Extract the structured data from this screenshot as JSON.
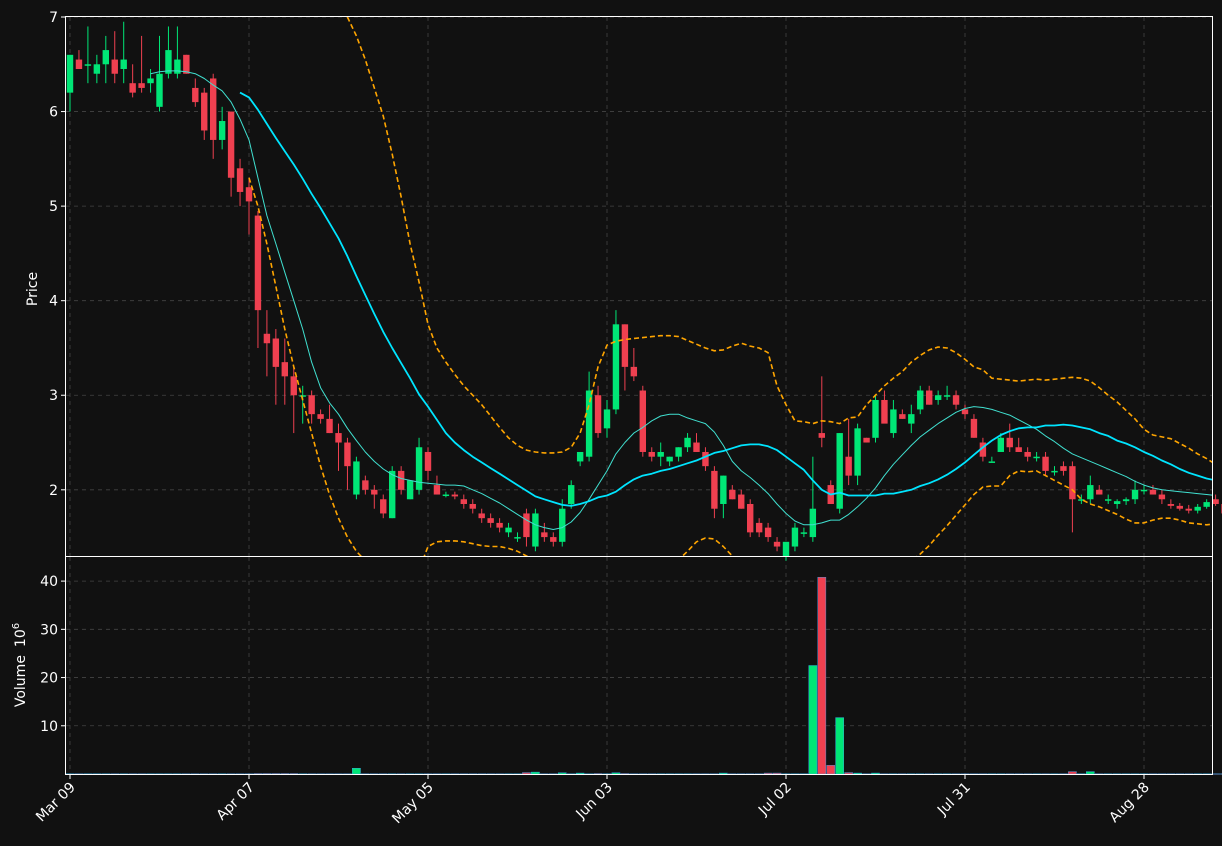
{
  "chart_data": {
    "type": "candlestick",
    "price_panel": {
      "ylabel": "Price",
      "ylim": [
        1.3,
        7.0
      ],
      "yticks": [
        2,
        3,
        4,
        5,
        6,
        7
      ],
      "grid": true
    },
    "volume_panel": {
      "ylabel": "Volume",
      "ylabel_exponent": "6",
      "ylim": [
        0,
        45
      ],
      "yticks": [
        10,
        20,
        30,
        40
      ],
      "grid": true
    },
    "x_axis": {
      "tick_labels": [
        "Mar 09",
        "Apr 07",
        "May 05",
        "Jun 03",
        "Jul 02",
        "Jul 31",
        "Aug 28"
      ],
      "tick_index": [
        0,
        20,
        40,
        60,
        80,
        100,
        120
      ]
    },
    "colors": {
      "background": "#111111",
      "up": "#00e676",
      "down": "#ef4050",
      "grid": "#444444",
      "axis": "#ffffff",
      "ma_fast": "#40e0d0",
      "ma_slow": "#00e5ff",
      "bands": "#ffa500"
    },
    "candles": [
      [
        6.2,
        6.6,
        6.0,
        6.6,
        0.05
      ],
      [
        6.55,
        6.65,
        6.45,
        6.45,
        0.05
      ],
      [
        6.5,
        6.9,
        6.3,
        6.5,
        0.05
      ],
      [
        6.4,
        6.6,
        6.3,
        6.5,
        0.05
      ],
      [
        6.5,
        6.8,
        6.3,
        6.65,
        0.05
      ],
      [
        6.55,
        6.85,
        6.3,
        6.4,
        0.05
      ],
      [
        6.45,
        6.95,
        6.3,
        6.55,
        0.05
      ],
      [
        6.3,
        6.5,
        6.15,
        6.2,
        0.05
      ],
      [
        6.3,
        6.8,
        6.2,
        6.25,
        0.05
      ],
      [
        6.3,
        6.45,
        6.2,
        6.35,
        0.05
      ],
      [
        6.05,
        6.8,
        6.0,
        6.4,
        0.05
      ],
      [
        6.4,
        6.9,
        6.35,
        6.65,
        0.05
      ],
      [
        6.4,
        6.9,
        6.35,
        6.55,
        0.05
      ],
      [
        6.6,
        6.6,
        6.4,
        6.4,
        0.05
      ],
      [
        6.25,
        6.35,
        6.05,
        6.1,
        0.05
      ],
      [
        6.2,
        6.25,
        5.7,
        5.8,
        0.05
      ],
      [
        6.35,
        6.4,
        5.5,
        5.7,
        0.05
      ],
      [
        5.7,
        6.05,
        5.6,
        5.9,
        0.05
      ],
      [
        6.0,
        6.0,
        5.1,
        5.3,
        0.05
      ],
      [
        5.4,
        5.5,
        5.0,
        5.15,
        0.05
      ],
      [
        5.2,
        5.3,
        4.7,
        5.05,
        0.05
      ],
      [
        4.9,
        4.95,
        3.5,
        3.9,
        0.1
      ],
      [
        3.65,
        3.9,
        3.2,
        3.55,
        0.1
      ],
      [
        3.6,
        3.7,
        2.9,
        3.3,
        0.1
      ],
      [
        3.35,
        3.6,
        2.9,
        3.2,
        0.1
      ],
      [
        3.2,
        3.3,
        2.6,
        3.0,
        0.1
      ],
      [
        3.0,
        3.1,
        2.7,
        3.0,
        0.05
      ],
      [
        3.0,
        3.05,
        2.7,
        2.8,
        0.05
      ],
      [
        2.8,
        2.85,
        2.7,
        2.75,
        0.05
      ],
      [
        2.75,
        2.9,
        2.6,
        2.6,
        0.05
      ],
      [
        2.6,
        2.7,
        2.2,
        2.5,
        0.05
      ],
      [
        2.5,
        2.55,
        2.0,
        2.25,
        0.05
      ],
      [
        1.95,
        2.35,
        1.9,
        2.3,
        1.2
      ],
      [
        2.1,
        2.15,
        1.95,
        2.0,
        0.05
      ],
      [
        2.0,
        2.05,
        1.8,
        1.95,
        0.05
      ],
      [
        1.9,
        1.95,
        1.7,
        1.75,
        0.05
      ],
      [
        1.7,
        2.25,
        1.7,
        2.2,
        0.05
      ],
      [
        2.2,
        2.25,
        1.95,
        2.0,
        0.05
      ],
      [
        1.9,
        2.1,
        1.9,
        2.1,
        0.05
      ],
      [
        2.0,
        2.55,
        1.95,
        2.45,
        0.05
      ],
      [
        2.4,
        2.45,
        2.1,
        2.2,
        0.05
      ],
      [
        2.05,
        2.15,
        1.95,
        1.95,
        0.05
      ],
      [
        1.95,
        1.98,
        1.92,
        1.95,
        0.05
      ],
      [
        1.95,
        1.98,
        1.9,
        1.93,
        0.05
      ],
      [
        1.9,
        1.95,
        1.8,
        1.85,
        0.05
      ],
      [
        1.85,
        1.9,
        1.75,
        1.8,
        0.05
      ],
      [
        1.75,
        1.8,
        1.65,
        1.7,
        0.05
      ],
      [
        1.7,
        1.75,
        1.6,
        1.65,
        0.05
      ],
      [
        1.65,
        1.7,
        1.55,
        1.6,
        0.05
      ],
      [
        1.55,
        1.65,
        1.5,
        1.6,
        0.05
      ],
      [
        1.5,
        1.55,
        1.45,
        1.5,
        0.05
      ],
      [
        1.75,
        1.8,
        1.4,
        1.5,
        0.3
      ],
      [
        1.4,
        1.8,
        1.35,
        1.75,
        0.4
      ],
      [
        1.55,
        1.65,
        1.45,
        1.5,
        0.05
      ],
      [
        1.5,
        1.55,
        1.4,
        1.45,
        0.05
      ],
      [
        1.45,
        1.9,
        1.4,
        1.8,
        0.25
      ],
      [
        1.85,
        2.1,
        1.8,
        2.05,
        0.05
      ],
      [
        2.3,
        2.4,
        2.25,
        2.4,
        0.2
      ],
      [
        2.35,
        3.25,
        2.3,
        3.05,
        0.05
      ],
      [
        3.0,
        3.1,
        2.55,
        2.6,
        0.1
      ],
      [
        2.65,
        2.95,
        2.55,
        2.85,
        0.05
      ],
      [
        2.85,
        3.9,
        2.8,
        3.75,
        0.25
      ],
      [
        3.75,
        3.75,
        3.05,
        3.3,
        0.1
      ],
      [
        3.3,
        3.5,
        3.15,
        3.2,
        0.05
      ],
      [
        3.05,
        3.1,
        2.35,
        2.4,
        0.05
      ],
      [
        2.4,
        2.45,
        2.3,
        2.35,
        0.05
      ],
      [
        2.35,
        2.5,
        2.25,
        2.4,
        0.05
      ],
      [
        2.3,
        2.35,
        2.25,
        2.35,
        0.05
      ],
      [
        2.35,
        2.45,
        2.3,
        2.45,
        0.05
      ],
      [
        2.45,
        2.6,
        2.4,
        2.55,
        0.05
      ],
      [
        2.5,
        2.6,
        2.4,
        2.4,
        0.05
      ],
      [
        2.4,
        2.45,
        2.2,
        2.25,
        0.05
      ],
      [
        2.2,
        2.25,
        1.7,
        1.8,
        0.05
      ],
      [
        1.85,
        2.15,
        1.7,
        2.15,
        0.2
      ],
      [
        2.0,
        2.05,
        1.9,
        1.9,
        0.05
      ],
      [
        1.95,
        2.0,
        1.8,
        1.8,
        0.05
      ],
      [
        1.85,
        1.9,
        1.5,
        1.55,
        0.05
      ],
      [
        1.65,
        1.7,
        1.5,
        1.55,
        0.05
      ],
      [
        1.6,
        1.65,
        1.45,
        1.5,
        0.2
      ],
      [
        1.45,
        1.5,
        1.35,
        1.4,
        0.2
      ],
      [
        1.3,
        1.45,
        1.25,
        1.45,
        0.05
      ],
      [
        1.4,
        1.65,
        1.35,
        1.6,
        0.05
      ],
      [
        1.55,
        1.6,
        1.5,
        1.55,
        0.05
      ],
      [
        1.5,
        2.35,
        1.45,
        1.8,
        22.5
      ],
      [
        2.6,
        3.2,
        2.45,
        2.55,
        40.8
      ],
      [
        2.05,
        2.1,
        1.9,
        1.85,
        1.8
      ],
      [
        1.8,
        2.6,
        1.75,
        2.6,
        11.7
      ],
      [
        2.35,
        2.75,
        2.05,
        2.15,
        0.3
      ],
      [
        2.15,
        2.7,
        2.05,
        2.65,
        0.2
      ],
      [
        2.55,
        2.55,
        2.5,
        2.5,
        0.05
      ],
      [
        2.55,
        3.0,
        2.5,
        2.95,
        0.2
      ],
      [
        2.95,
        3.05,
        2.8,
        2.7,
        0.05
      ],
      [
        2.6,
        2.95,
        2.55,
        2.85,
        0.05
      ],
      [
        2.8,
        2.85,
        2.75,
        2.75,
        0.05
      ],
      [
        2.7,
        2.9,
        2.6,
        2.8,
        0.05
      ],
      [
        2.85,
        3.1,
        2.8,
        3.05,
        0.05
      ],
      [
        3.05,
        3.1,
        2.9,
        2.9,
        0.05
      ],
      [
        2.95,
        3.05,
        2.9,
        3.0,
        0.05
      ],
      [
        3.0,
        3.1,
        2.95,
        3.0,
        0.05
      ],
      [
        3.0,
        3.05,
        2.85,
        2.9,
        0.05
      ],
      [
        2.85,
        2.9,
        2.75,
        2.8,
        0.05
      ],
      [
        2.75,
        2.8,
        2.55,
        2.55,
        0.05
      ],
      [
        2.5,
        2.55,
        2.3,
        2.35,
        0.05
      ],
      [
        2.3,
        2.35,
        2.3,
        2.3,
        0.05
      ],
      [
        2.4,
        2.6,
        2.4,
        2.55,
        0.05
      ],
      [
        2.55,
        2.7,
        2.4,
        2.45,
        0.05
      ],
      [
        2.45,
        2.55,
        2.4,
        2.4,
        0.05
      ],
      [
        2.4,
        2.45,
        2.3,
        2.35,
        0.05
      ],
      [
        2.35,
        2.4,
        2.3,
        2.35,
        0.05
      ],
      [
        2.35,
        2.4,
        2.15,
        2.2,
        0.05
      ],
      [
        2.2,
        2.25,
        2.15,
        2.2,
        0.05
      ],
      [
        2.25,
        2.3,
        2.15,
        2.2,
        0.05
      ],
      [
        2.25,
        2.3,
        1.55,
        1.9,
        0.5
      ],
      [
        1.9,
        1.95,
        1.85,
        1.9,
        0.05
      ],
      [
        1.9,
        2.15,
        1.85,
        2.05,
        0.5
      ],
      [
        2.0,
        2.05,
        1.95,
        1.95,
        0.05
      ],
      [
        1.9,
        1.95,
        1.85,
        1.9,
        0.05
      ],
      [
        1.85,
        1.9,
        1.8,
        1.88,
        0.05
      ],
      [
        1.88,
        1.92,
        1.84,
        1.9,
        0.05
      ],
      [
        1.9,
        2.1,
        1.85,
        2.0,
        0.05
      ],
      [
        2.0,
        2.05,
        1.95,
        2.0,
        0.05
      ],
      [
        2.0,
        2.05,
        1.95,
        1.95,
        0.05
      ],
      [
        1.95,
        2.0,
        1.85,
        1.9,
        0.05
      ],
      [
        1.85,
        1.9,
        1.8,
        1.83,
        0.05
      ],
      [
        1.83,
        1.86,
        1.78,
        1.8,
        0.05
      ],
      [
        1.8,
        1.84,
        1.75,
        1.78,
        0.05
      ],
      [
        1.78,
        1.85,
        1.75,
        1.82,
        0.05
      ],
      [
        1.82,
        1.9,
        1.8,
        1.87,
        0.05
      ],
      [
        1.9,
        1.95,
        1.83,
        1.85,
        0.05
      ],
      [
        1.85,
        1.88,
        1.75,
        1.75,
        0.05
      ]
    ],
    "ma_fast": [
      null,
      null,
      null,
      null,
      null,
      null,
      null,
      null,
      null,
      6.4,
      6.42,
      6.43,
      6.43,
      6.42,
      6.4,
      6.35,
      6.28,
      6.22,
      6.1,
      5.92,
      5.7,
      5.3,
      4.9,
      4.6,
      4.3,
      4.0,
      3.7,
      3.35,
      3.08,
      2.92,
      2.8,
      2.65,
      2.52,
      2.4,
      2.3,
      2.22,
      2.16,
      2.12,
      2.1,
      2.08,
      2.07,
      2.06,
      2.05,
      2.05,
      2.04,
      2.0,
      1.96,
      1.91,
      1.86,
      1.8,
      1.74,
      1.68,
      1.63,
      1.6,
      1.58,
      1.6,
      1.66,
      1.76,
      1.9,
      2.05,
      2.2,
      2.38,
      2.5,
      2.6,
      2.66,
      2.73,
      2.78,
      2.8,
      2.8,
      2.76,
      2.73,
      2.7,
      2.61,
      2.47,
      2.3,
      2.2,
      2.13,
      2.05,
      1.96,
      1.85,
      1.75,
      1.67,
      1.63,
      1.63,
      1.65,
      1.68,
      1.68,
      1.74,
      1.82,
      1.91,
      2.02,
      2.15,
      2.27,
      2.37,
      2.47,
      2.56,
      2.63,
      2.7,
      2.76,
      2.82,
      2.86,
      2.88,
      2.87,
      2.85,
      2.82,
      2.79,
      2.74,
      2.69,
      2.64,
      2.57,
      2.51,
      2.44,
      2.38,
      2.34,
      2.3,
      2.26,
      2.22,
      2.18,
      2.14,
      2.09,
      2.05,
      2.02,
      2.0,
      1.99,
      1.98,
      1.97,
      1.96,
      1.95,
      1.94,
      1.93,
      1.92,
      1.9,
      1.88,
      1.87
    ],
    "ma_slow": [
      null,
      null,
      null,
      null,
      null,
      null,
      null,
      null,
      null,
      null,
      null,
      null,
      null,
      null,
      null,
      null,
      null,
      null,
      null,
      6.2,
      6.15,
      6.02,
      5.87,
      5.72,
      5.58,
      5.44,
      5.29,
      5.13,
      4.98,
      4.82,
      4.66,
      4.47,
      4.26,
      4.06,
      3.86,
      3.67,
      3.5,
      3.34,
      3.18,
      3.01,
      2.88,
      2.74,
      2.6,
      2.5,
      2.42,
      2.35,
      2.29,
      2.23,
      2.17,
      2.11,
      2.05,
      1.99,
      1.93,
      1.9,
      1.87,
      1.84,
      1.83,
      1.85,
      1.88,
      1.92,
      1.94,
      1.98,
      2.05,
      2.11,
      2.15,
      2.17,
      2.2,
      2.22,
      2.25,
      2.28,
      2.31,
      2.35,
      2.39,
      2.41,
      2.44,
      2.47,
      2.48,
      2.48,
      2.46,
      2.42,
      2.35,
      2.28,
      2.21,
      2.1,
      2.0,
      1.95,
      1.97,
      1.94,
      1.94,
      1.94,
      1.94,
      1.96,
      1.96,
      1.98,
      2.0,
      2.04,
      2.07,
      2.11,
      2.16,
      2.22,
      2.29,
      2.37,
      2.45,
      2.52,
      2.58,
      2.62,
      2.65,
      2.66,
      2.66,
      2.68,
      2.68,
      2.69,
      2.68,
      2.66,
      2.64,
      2.6,
      2.57,
      2.52,
      2.49,
      2.45,
      2.4,
      2.36,
      2.31,
      2.27,
      2.22,
      2.18,
      2.15,
      2.12,
      2.1,
      2.07,
      2.03,
      2.0,
      1.97,
      1.94
    ],
    "upper_band": [
      null,
      null,
      null,
      null,
      null,
      null,
      null,
      null,
      null,
      null,
      null,
      null,
      null,
      null,
      null,
      null,
      null,
      null,
      null,
      null,
      null,
      null,
      null,
      null,
      null,
      null,
      null,
      null,
      null,
      null,
      null,
      7.0,
      6.8,
      6.55,
      6.25,
      5.95,
      5.55,
      5.1,
      4.6,
      4.2,
      3.75,
      3.5,
      3.35,
      3.22,
      3.1,
      3.0,
      2.9,
      2.78,
      2.66,
      2.55,
      2.47,
      2.42,
      2.4,
      2.39,
      2.39,
      2.4,
      2.45,
      2.6,
      2.9,
      3.3,
      3.53,
      3.57,
      3.59,
      3.6,
      3.61,
      3.62,
      3.63,
      3.63,
      3.62,
      3.58,
      3.54,
      3.5,
      3.47,
      3.48,
      3.52,
      3.55,
      3.52,
      3.5,
      3.45,
      3.1,
      2.9,
      2.73,
      2.72,
      2.7,
      2.73,
      2.72,
      2.7,
      2.76,
      2.77,
      2.9,
      3.0,
      3.1,
      3.18,
      3.25,
      3.35,
      3.42,
      3.48,
      3.51,
      3.5,
      3.45,
      3.38,
      3.3,
      3.27,
      3.18,
      3.17,
      3.16,
      3.15,
      3.16,
      3.17,
      3.16,
      3.17,
      3.18,
      3.19,
      3.18,
      3.15,
      3.08,
      3.0,
      2.93,
      2.84,
      2.75,
      2.64,
      2.58,
      2.56,
      2.54,
      2.49,
      2.44,
      2.38,
      2.33,
      2.27,
      2.21,
      2.16
    ],
    "lower_band": [
      null,
      null,
      null,
      null,
      null,
      null,
      null,
      null,
      null,
      null,
      null,
      null,
      null,
      null,
      null,
      null,
      null,
      null,
      null,
      null,
      5.3,
      5.0,
      4.6,
      4.15,
      3.7,
      3.3,
      2.95,
      2.6,
      2.25,
      1.95,
      1.7,
      1.5,
      1.35,
      1.25,
      1.1,
      0.95,
      0.85,
      0.85,
      0.95,
      1.15,
      1.4,
      1.45,
      1.46,
      1.46,
      1.45,
      1.43,
      1.41,
      1.4,
      1.4,
      1.38,
      1.35,
      1.3,
      1.26,
      1.25,
      1.24,
      1.2,
      1.1,
      1.0,
      0.9,
      0.95,
      0.95,
      0.97,
      1.0,
      1.05,
      1.08,
      1.1,
      1.18,
      1.23,
      1.26,
      1.35,
      1.45,
      1.49,
      1.48,
      1.4,
      1.3,
      1.22,
      1.15,
      1.1,
      1.05,
      1.05,
      1.05,
      1.05,
      1.05,
      1.05,
      1.05,
      1.05,
      1.05,
      1.05,
      1.05,
      1.05,
      1.05,
      1.1,
      1.15,
      1.2,
      1.25,
      1.32,
      1.41,
      1.52,
      1.62,
      1.73,
      1.84,
      1.95,
      2.03,
      2.04,
      2.04,
      2.15,
      2.2,
      2.19,
      2.2,
      2.15,
      2.1,
      2.05,
      2.0,
      1.9,
      1.85,
      1.82,
      1.78,
      1.74,
      1.69,
      1.65,
      1.65,
      1.68,
      1.7,
      1.7,
      1.68,
      1.65,
      1.64,
      1.63,
      1.64,
      1.66,
      1.69
    ]
  }
}
